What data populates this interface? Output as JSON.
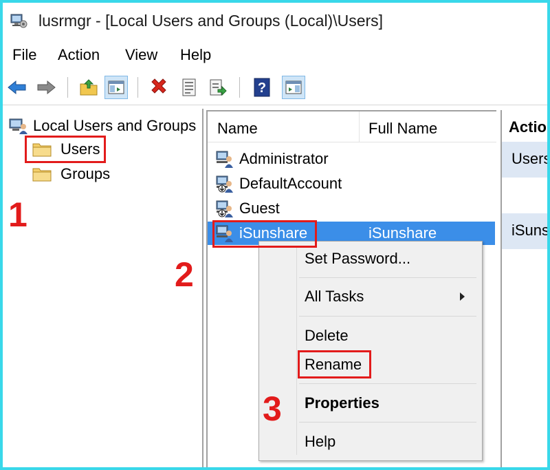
{
  "window": {
    "title": "lusrmgr - [Local Users and Groups (Local)\\Users]",
    "icon": "computer-management-icon"
  },
  "menu": [
    "File",
    "Action",
    "View",
    "Help"
  ],
  "toolbar": {
    "buttons": [
      {
        "name": "back-arrow-icon"
      },
      {
        "name": "forward-arrow-icon"
      },
      {
        "name": "up-folder-icon"
      },
      {
        "name": "show-hide-console-tree-icon",
        "pressed": true
      },
      {
        "name": "delete-icon"
      },
      {
        "name": "properties-icon"
      },
      {
        "name": "export-list-icon"
      },
      {
        "name": "help-icon"
      },
      {
        "name": "show-hide-action-pane-icon",
        "pressed": true
      }
    ]
  },
  "tree": {
    "root": "Local Users and Groups",
    "children": [
      "Users",
      "Groups"
    ]
  },
  "list": {
    "columns": [
      "Name",
      "Full Name"
    ],
    "rows": [
      {
        "name": "Administrator",
        "full_name": ""
      },
      {
        "name": "DefaultAccount",
        "full_name": ""
      },
      {
        "name": "Guest",
        "full_name": ""
      },
      {
        "name": "iSunshare",
        "full_name": "iSunshare",
        "selected": true
      }
    ]
  },
  "actions": {
    "title": "Actio",
    "sections": [
      "Users",
      "iSuns"
    ]
  },
  "context_menu": {
    "items": [
      "Set Password...",
      "All Tasks",
      "Delete",
      "Rename",
      "Properties",
      "Help"
    ]
  },
  "annotations": {
    "steps": [
      "1",
      "2",
      "3"
    ],
    "highlight_color": "#e21b1b",
    "frame_color": "#39d8ea"
  },
  "colors": {
    "selection": "#3b8ee8"
  }
}
